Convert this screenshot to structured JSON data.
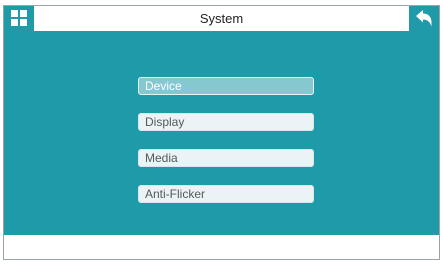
{
  "header": {
    "title": "System"
  },
  "menu": {
    "items": [
      {
        "label": "Device",
        "selected": true
      },
      {
        "label": "Display",
        "selected": false
      },
      {
        "label": "Media",
        "selected": false
      },
      {
        "label": "Anti-Flicker",
        "selected": false
      }
    ]
  },
  "icons": {
    "home": "home-grid-icon",
    "back": "back-arrow-icon"
  },
  "colors": {
    "accent": "#1e9aa8",
    "selected_item": "#86c8cf",
    "item_background": "#eaf3f5"
  }
}
